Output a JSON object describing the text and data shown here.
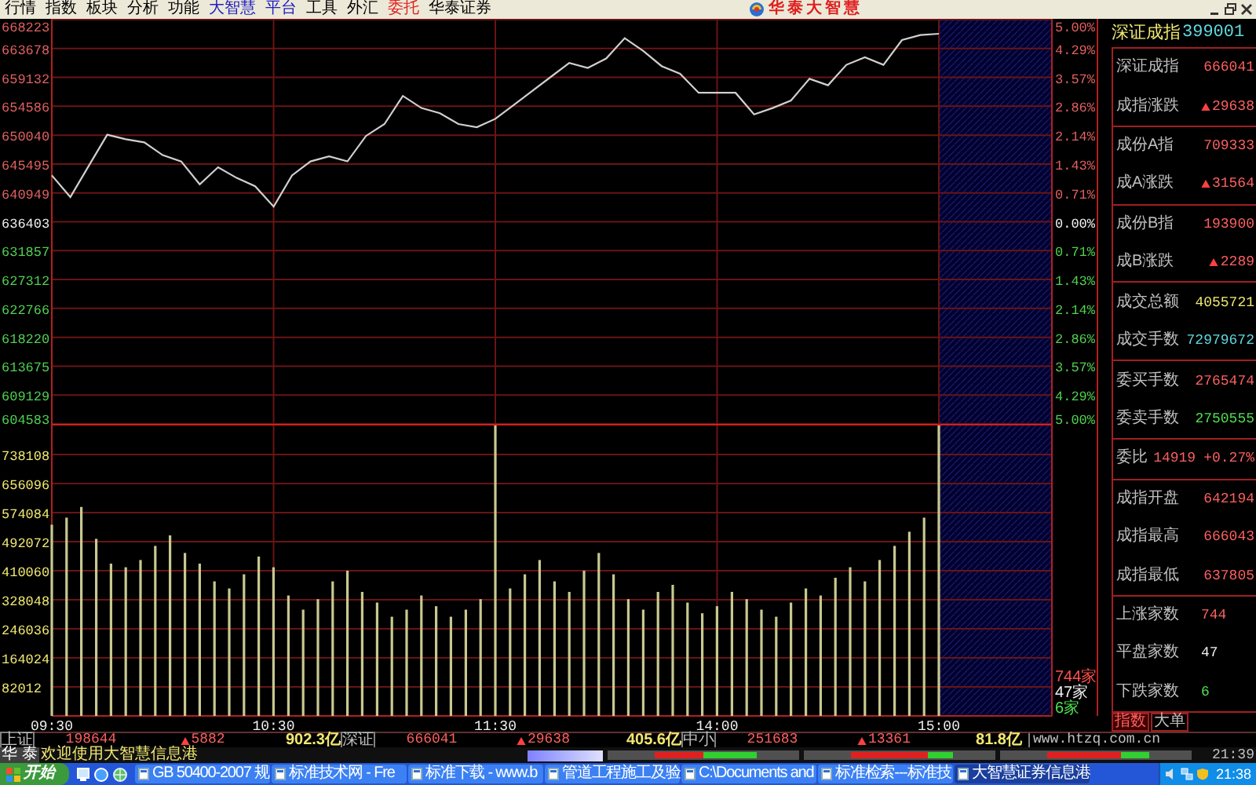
{
  "menu_bar": {
    "items": [
      {
        "label": "行情",
        "color": "#000000"
      },
      {
        "label": "指数",
        "color": "#000000"
      },
      {
        "label": "板块",
        "color": "#000000"
      },
      {
        "label": "分析",
        "color": "#000000"
      },
      {
        "label": "功能",
        "color": "#000000"
      },
      {
        "label": "大智慧",
        "color": "#2020c0"
      },
      {
        "label": "平台",
        "color": "#2020c0"
      },
      {
        "label": "工具",
        "color": "#000000"
      },
      {
        "label": "外汇",
        "color": "#000000"
      },
      {
        "label": "委托",
        "color": "#e02020"
      },
      {
        "label": "华泰证券",
        "color": "#000000"
      }
    ],
    "title": "华泰大智慧"
  },
  "price_chart": {
    "chart_data": {
      "type": "line",
      "grid": true,
      "ylim": [
        604583,
        668223
      ],
      "yticks": [
        668223,
        663678,
        659132,
        654586,
        650040,
        645495,
        640949,
        636403,
        631857,
        627312,
        622766,
        618220,
        613675,
        609129,
        604583
      ],
      "series": [
        {
          "color": "#d0d0d0",
          "values": [
            643700,
            640300,
            645200,
            650100,
            649400,
            648900,
            646900,
            645900,
            642300,
            645000,
            643300,
            642000,
            638800,
            643700,
            645900,
            646700,
            645900,
            649900,
            651800,
            656200,
            654300,
            653500,
            651800,
            651300,
            652600,
            654800,
            657000,
            659200,
            661400,
            660600,
            662100,
            665300,
            663300,
            660900,
            659700,
            656700,
            656700,
            656700,
            653300,
            654300,
            655500,
            658900,
            657900,
            661100,
            662300,
            661100,
            665000,
            665800,
            666000
          ]
        }
      ]
    },
    "percent_labels": [
      "5.00%",
      "4.29%",
      "3.57%",
      "2.86%",
      "2.14%",
      "1.43%",
      "0.71%",
      "0.00%",
      "0.71%",
      "1.43%",
      "2.14%",
      "2.86%",
      "3.57%",
      "4.29%",
      "5.00%"
    ]
  },
  "volume_chart": {
    "chart_data": {
      "type": "bar",
      "grid": true,
      "ylim": [
        0,
        820120
      ],
      "yticks": [
        738108,
        656096,
        574084,
        492072,
        410060,
        328048,
        246036,
        164024,
        82012
      ],
      "categories": [
        "09:30",
        null,
        null,
        null,
        null,
        null,
        null,
        null,
        null,
        null,
        null,
        null,
        null,
        null,
        null,
        "10:30",
        null,
        null,
        null,
        null,
        null,
        null,
        null,
        null,
        null,
        null,
        null,
        null,
        null,
        null,
        "11:30",
        null,
        null,
        null,
        null,
        null,
        null,
        null,
        null,
        null,
        null,
        null,
        null,
        null,
        null,
        "14:00",
        null,
        null,
        null,
        null,
        null,
        null,
        null,
        null,
        null,
        null,
        null,
        null,
        null,
        null,
        "15:00"
      ],
      "series": [
        {
          "color": "#c8c890",
          "values": [
            540000,
            560000,
            590000,
            500000,
            430000,
            420000,
            440000,
            480000,
            510000,
            460000,
            430000,
            380000,
            360000,
            400000,
            450000,
            420000,
            340000,
            300000,
            330000,
            380000,
            410000,
            350000,
            320000,
            280000,
            300000,
            340000,
            310000,
            280000,
            300000,
            330000,
            820000,
            360000,
            400000,
            440000,
            380000,
            350000,
            410000,
            460000,
            400000,
            330000,
            300000,
            350000,
            370000,
            320000,
            290000,
            310000,
            350000,
            330000,
            300000,
            280000,
            320000,
            360000,
            340000,
            390000,
            420000,
            380000,
            440000,
            480000,
            520000,
            560000,
            820000
          ]
        }
      ]
    },
    "breadth_labels": [
      {
        "text": "744家",
        "color": "#ff5050"
      },
      {
        "text": "47家",
        "color": "#f0f0f0"
      },
      {
        "text": "6家",
        "color": "#50e050"
      }
    ]
  },
  "index_panel": {
    "name": "深证成指",
    "code": "399001",
    "groups": [
      {
        "rows": [
          {
            "kind": "figure",
            "label": "深证成指",
            "value": "666041",
            "color": "#ff6060",
            "up_arrow": false
          },
          {
            "kind": "figure",
            "label": "成指涨跌",
            "value": "29638",
            "color": "#ff6060",
            "up_arrow": true
          }
        ]
      },
      {
        "rows": [
          {
            "kind": "figure",
            "label": "成份A指",
            "value": "709333",
            "color": "#ff6060",
            "up_arrow": false
          },
          {
            "kind": "figure",
            "label": "成A涨跌",
            "value": "31564",
            "color": "#ff6060",
            "up_arrow": true
          }
        ]
      },
      {
        "rows": [
          {
            "kind": "figure",
            "label": "成份B指",
            "value": "193900",
            "color": "#ff6060",
            "up_arrow": false
          },
          {
            "kind": "figure",
            "label": "成B涨跌",
            "value": "2289",
            "color": "#ff6060",
            "up_arrow": true
          }
        ]
      },
      {
        "rows": [
          {
            "kind": "figure",
            "label": "成交总额",
            "value": "4055721",
            "color": "#f0e870",
            "up_arrow": false
          },
          {
            "kind": "figure",
            "label": "成交手数",
            "value": "72979672",
            "color": "#60d8e0",
            "up_arrow": false
          }
        ]
      },
      {
        "rows": [
          {
            "kind": "figure",
            "label": "委买手数",
            "value": "2765474",
            "color": "#ff6060",
            "up_arrow": false
          },
          {
            "kind": "figure",
            "label": "委卖手数",
            "value": "2750555",
            "color": "#50e050",
            "up_arrow": false
          }
        ]
      },
      {
        "rows": [
          {
            "kind": "ratio",
            "label": "委比",
            "value": "14919",
            "extra": "+0.27%",
            "color": "#ff6060",
            "up_arrow": false
          }
        ]
      },
      {
        "rows": [
          {
            "kind": "figure",
            "label": "成指开盘",
            "value": "642194",
            "color": "#ff6060",
            "up_arrow": false
          },
          {
            "kind": "figure",
            "label": "成指最高",
            "value": "666043",
            "color": "#ff6060",
            "up_arrow": false
          },
          {
            "kind": "figure",
            "label": "成指最低",
            "value": "637805",
            "color": "#ff6060",
            "up_arrow": false
          }
        ]
      },
      {
        "rows": [
          {
            "kind": "count",
            "label": "上涨家数",
            "value": "744",
            "color": "#ff6060",
            "up_arrow": false
          },
          {
            "kind": "count",
            "label": "平盘家数",
            "value": "47",
            "color": "#f0f0f0",
            "up_arrow": false
          },
          {
            "kind": "count",
            "label": "下跌家数",
            "value": "6",
            "color": "#50e050",
            "up_arrow": false
          }
        ]
      }
    ],
    "tabs": [
      {
        "label": "指数",
        "selected": true
      },
      {
        "label": "大单",
        "selected": false
      }
    ]
  },
  "status_bar": {
    "markets": [
      {
        "name": "上证",
        "value": "198644",
        "change": "5882",
        "up_arrow": true,
        "amount": "902.3亿"
      },
      {
        "name": "深证",
        "value": "666041",
        "change": "29638",
        "up_arrow": true,
        "amount": "405.6亿"
      },
      {
        "name": "中小",
        "value": "251683",
        "change": "13361",
        "up_arrow": true,
        "amount": "81.8亿"
      }
    ],
    "url": "www.htzq.com.cn"
  },
  "ticker": {
    "broker": "华 泰",
    "message": "欢迎使用大智慧信息港",
    "meters": [
      {
        "level": 0.48
      },
      {
        "level": 0.76
      },
      {
        "level": 0.72
      }
    ],
    "clock": "21:39"
  },
  "taskbar": {
    "start": "开始",
    "tasks": [
      {
        "label": "GB 50400-2007 规",
        "selected": false
      },
      {
        "label": "标准技术网 - Fre",
        "selected": false
      },
      {
        "label": "标准下载 - www.b",
        "selected": false
      },
      {
        "label": "管道工程施工及验",
        "selected": false
      },
      {
        "label": "C:\\Documents and",
        "selected": false
      },
      {
        "label": "标准检索---标准技",
        "selected": false
      },
      {
        "label": "大智慧证券信息港",
        "selected": true
      }
    ],
    "clock": "21:38"
  }
}
